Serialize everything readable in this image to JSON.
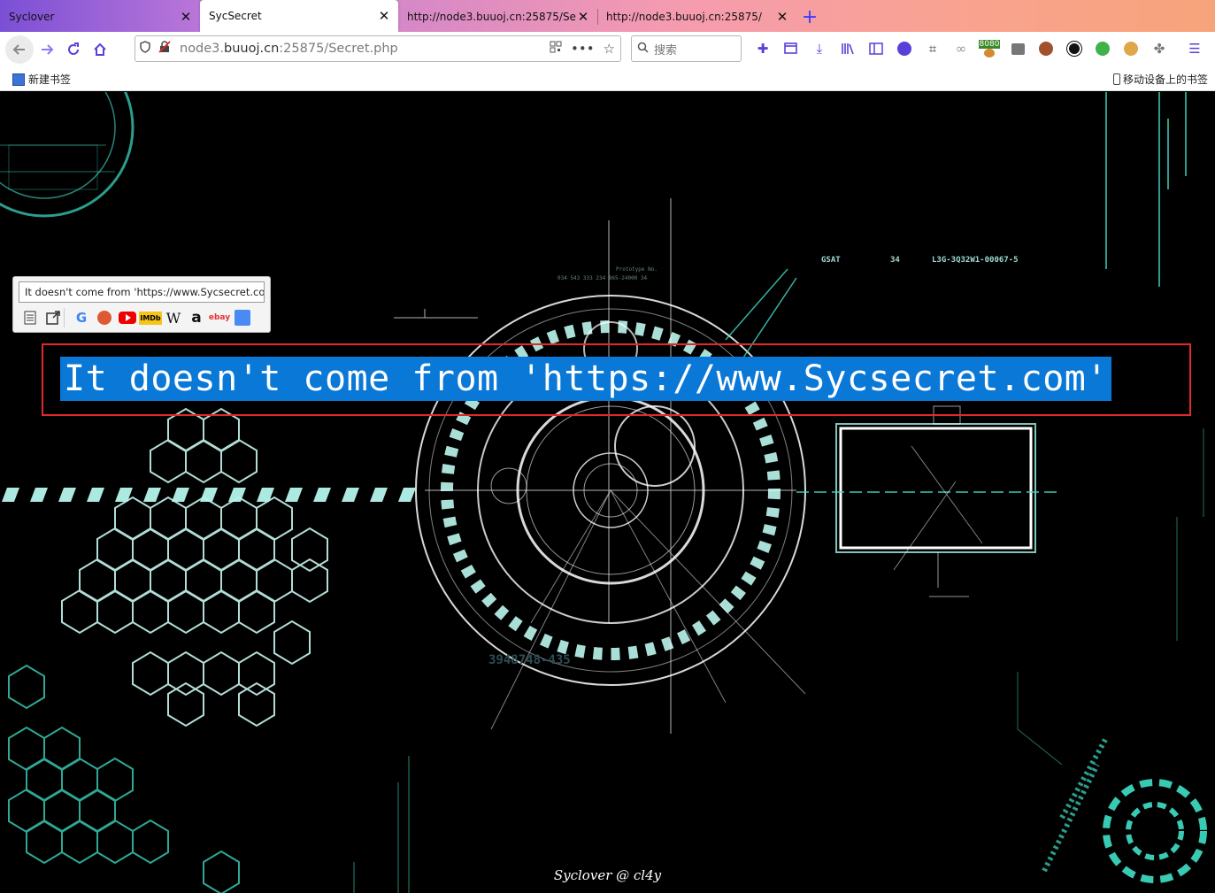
{
  "tabs": [
    {
      "title": "Syclover",
      "close": "✕",
      "active": false
    },
    {
      "title": "SycSecret",
      "close": "✕",
      "active": true
    },
    {
      "title": "http://node3.buuoj.cn:25875/Se",
      "close": "✕",
      "active": false
    },
    {
      "title": "http://node3.buuoj.cn:25875/",
      "close": "✕",
      "active": false
    }
  ],
  "new_tab": "+",
  "url": {
    "host_pre": "node3.",
    "host": "buuoj.cn",
    "rest": ":25875/Secret.php"
  },
  "search": {
    "placeholder": "搜索"
  },
  "extension_badge": "8080",
  "bookmarks": {
    "left": "新建书签",
    "right": "移动设备上的书签"
  },
  "popup": {
    "text": "It doesn't come from 'https://www.Sycsecret.co",
    "engines": [
      "reader",
      "open",
      "google",
      "duckduckgo",
      "youtube",
      "imdb",
      "wikipedia",
      "amazon",
      "ebay",
      "translate"
    ],
    "labels": {
      "google": "G",
      "imdb": "IMDb",
      "wikipedia": "W",
      "amazon": "a",
      "ebay": "ebay"
    }
  },
  "message": "It doesn't come from 'https://www.Sycsecret.com'",
  "footer": "Syclover @ cl4y",
  "hud": {
    "gsat": "GSAT",
    "gsat_num": "34",
    "code": "L3G-3Q32W1-00067-5",
    "prototype": "Prototype No.",
    "serial": "034 543 333 234 965-24000 34",
    "bottom_code": "3948748-435"
  },
  "colors": {
    "accent": "#0a78d7",
    "border": "#e02a2a",
    "hud": "#3fe0c8"
  }
}
